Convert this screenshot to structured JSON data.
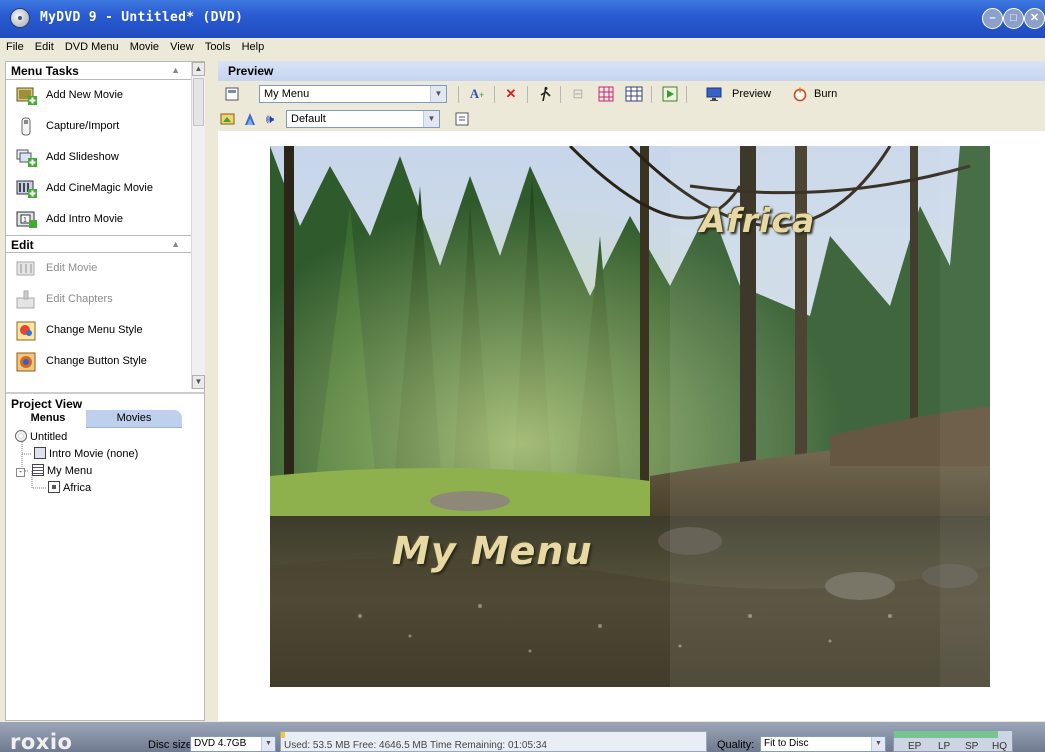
{
  "window": {
    "title": "MyDVD 9 - Untitled* (DVD)"
  },
  "menubar": [
    "File",
    "Edit",
    "DVD Menu",
    "Movie",
    "View",
    "Tools",
    "Help"
  ],
  "menu_tasks": {
    "header": "Menu Tasks",
    "items": [
      {
        "label": "Add New Movie",
        "icon": "add-movie-icon"
      },
      {
        "label": "Capture/Import",
        "icon": "capture-icon"
      },
      {
        "label": "Add Slideshow",
        "icon": "add-slideshow-icon"
      },
      {
        "label": "Add CineMagic Movie",
        "icon": "cinemagic-icon"
      },
      {
        "label": "Add Intro Movie",
        "icon": "intro-movie-icon"
      }
    ]
  },
  "edit_tasks": {
    "header": "Edit",
    "items": [
      {
        "label": "Edit Movie",
        "icon": "edit-movie-icon",
        "enabled": false
      },
      {
        "label": "Edit Chapters",
        "icon": "edit-chapters-icon",
        "enabled": false
      },
      {
        "label": "Change Menu Style",
        "icon": "menu-style-icon",
        "enabled": true
      },
      {
        "label": "Change Button Style",
        "icon": "button-style-icon",
        "enabled": true
      }
    ]
  },
  "project_view": {
    "header": "Project View",
    "tabs": [
      "Menus",
      "Movies"
    ],
    "active_tab": "Menus",
    "tree": [
      {
        "label": "Untitled",
        "level": 0
      },
      {
        "label": "Intro Movie (none)",
        "level": 1
      },
      {
        "label": "My Menu",
        "level": 1
      },
      {
        "label": "Africa",
        "level": 2
      }
    ]
  },
  "preview": {
    "header": "Preview",
    "menu_select": "My Menu",
    "audio_select": "Default",
    "preview_label": "Preview",
    "burn_label": "Burn",
    "menu_title": "My Menu",
    "button_label": "Africa"
  },
  "statusbar": {
    "brand": "roxio",
    "disc_size_label": "Disc size:",
    "disc_size_value": "DVD 4.7GB",
    "usage_text": "Used: 53.5 MB  Free: 4646.5 MB  Time Remaining: 01:05:34",
    "usage_fraction": 0.011,
    "quality_label": "Quality:",
    "quality_value": "Fit to Disc",
    "quality_levels": [
      "EP",
      "LP",
      "SP",
      "HQ"
    ],
    "quality_fraction": 0.88
  },
  "colors": {
    "titlebar": "#2a5bd1",
    "preview_header": "#c6d4f0",
    "menu_text": "#e8d9a4",
    "usage_fill": "#f2c83a",
    "quality_fill": "#77c391"
  }
}
